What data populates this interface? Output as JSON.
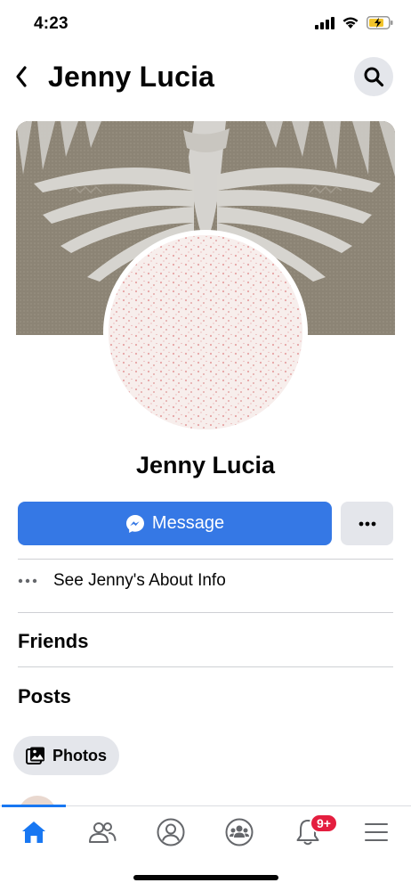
{
  "status_bar": {
    "time": "4:23",
    "icons": [
      "signal-icon",
      "wifi-icon",
      "battery-charging-icon"
    ]
  },
  "header": {
    "title": "Jenny Lucia",
    "back_icon": "chevron-left-icon",
    "search_icon": "search-icon"
  },
  "profile": {
    "name": "Jenny Lucia",
    "cover_photo": "cover-photo",
    "profile_picture": "profile-picture"
  },
  "actions": {
    "message_label": "Message",
    "message_icon": "messenger-icon",
    "more_icon": "more-dots-icon"
  },
  "about": {
    "label": "See Jenny's About Info",
    "icon": "more-dots-icon"
  },
  "sections": {
    "friends": "Friends",
    "posts": "Posts"
  },
  "photos_chip": {
    "label": "Photos",
    "icon": "photos-icon"
  },
  "tab_bar": {
    "tabs": [
      {
        "name": "home",
        "icon": "home-icon",
        "active": true
      },
      {
        "name": "friends",
        "icon": "friends-icon",
        "active": false
      },
      {
        "name": "profile",
        "icon": "profile-icon",
        "active": false
      },
      {
        "name": "groups",
        "icon": "groups-icon",
        "active": false
      },
      {
        "name": "notifications",
        "icon": "bell-icon",
        "active": false,
        "badge": "9+"
      },
      {
        "name": "menu",
        "icon": "menu-icon",
        "active": false
      }
    ]
  },
  "colors": {
    "accent": "#3578e5",
    "active_tab": "#1877f2",
    "badge": "#e41e3f",
    "chip_bg": "#e4e6eb"
  }
}
